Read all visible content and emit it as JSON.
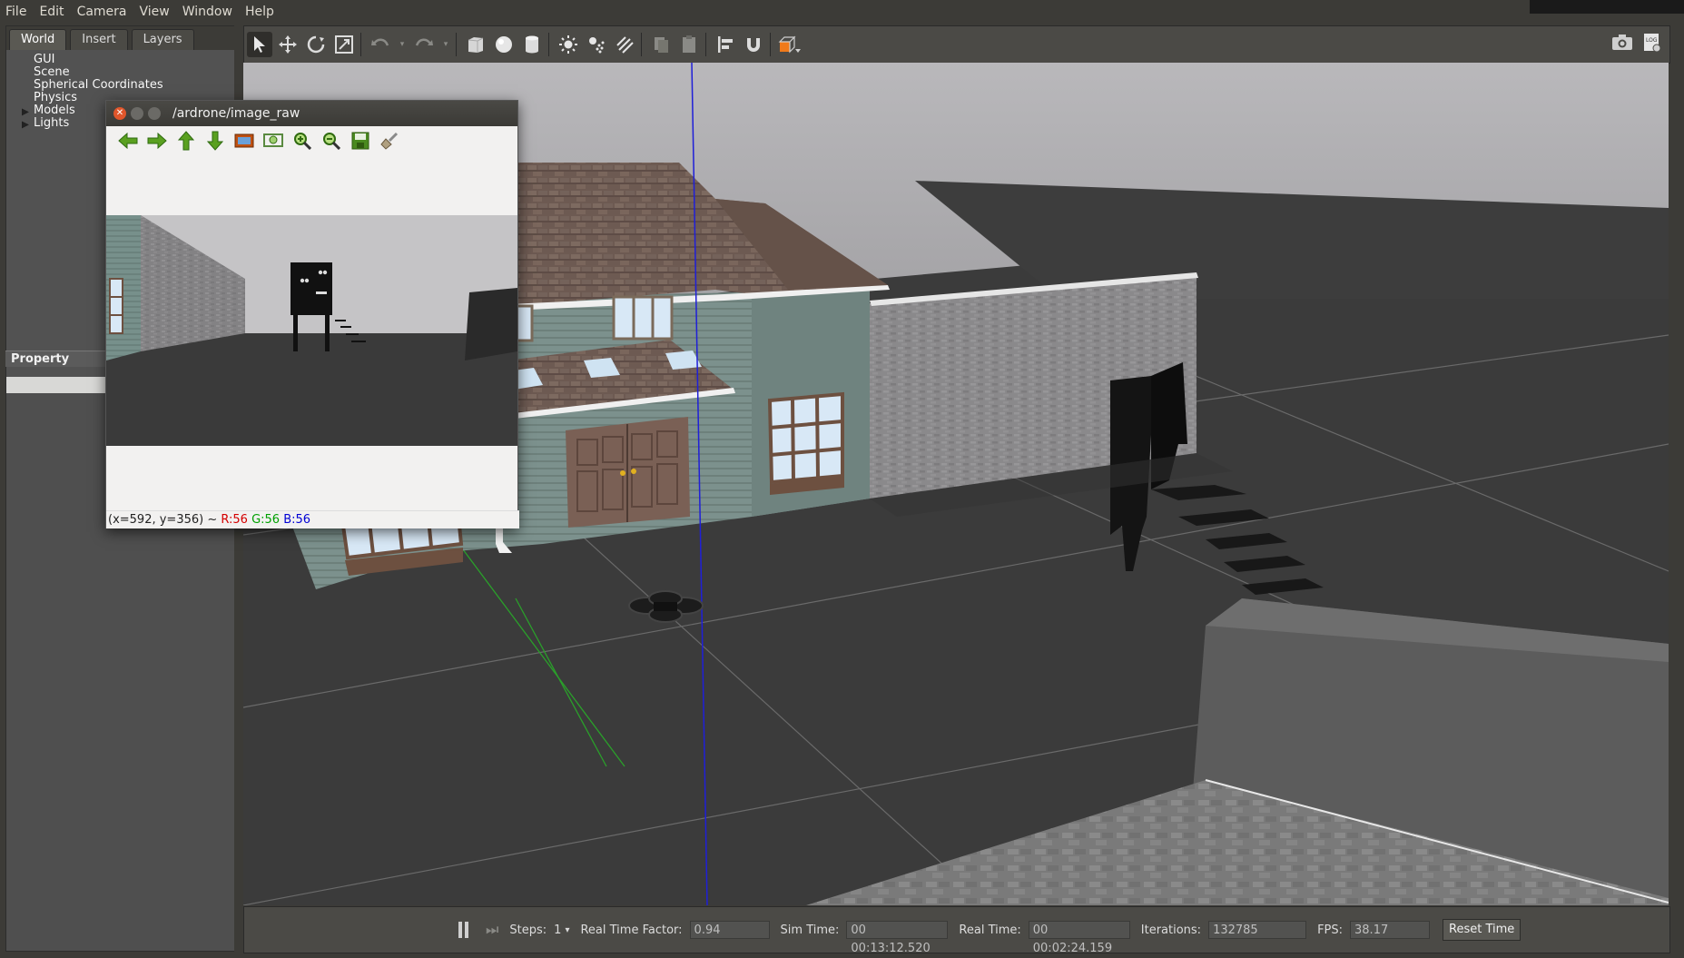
{
  "menu": [
    "File",
    "Edit",
    "Camera",
    "View",
    "Window",
    "Help"
  ],
  "left_panel": {
    "tabs": [
      "World",
      "Insert",
      "Layers"
    ],
    "tree_items": [
      {
        "label": "GUI",
        "expandable": false
      },
      {
        "label": "Scene",
        "expandable": false
      },
      {
        "label": "Spherical Coordinates",
        "expandable": false
      },
      {
        "label": "Physics",
        "expandable": false
      },
      {
        "label": "Models",
        "expandable": true
      },
      {
        "label": "Lights",
        "expandable": true
      }
    ],
    "property_header": "Property"
  },
  "toolbar": {
    "tools": [
      "select-icon",
      "translate-icon",
      "rotate-icon",
      "scale-icon",
      "undo-icon",
      "redo-icon",
      "box-icon",
      "sphere-icon",
      "cylinder-icon",
      "point-light-icon",
      "spot-light-icon",
      "directional-light-icon",
      "copy-icon",
      "paste-icon",
      "align-icon",
      "snap-icon",
      "view-angle-icon"
    ],
    "right_tools": [
      "screenshot-icon",
      "log-icon"
    ]
  },
  "image_window": {
    "title": "/ardrone/image_raw",
    "tools": [
      "back-icon",
      "forward-icon",
      "up-icon",
      "down-icon",
      "image-icon",
      "zoom-fit-icon",
      "zoom-in-icon",
      "zoom-out-icon",
      "save-icon",
      "clear-icon"
    ],
    "status_coords": "(x=592, y=356) ~ ",
    "status_r": "R:56",
    "status_g": "G:56",
    "status_b": "B:56"
  },
  "bottom_bar": {
    "steps_label": "Steps:",
    "steps_value": "1",
    "rtf_label": "Real Time Factor:",
    "rtf_value": "0.94",
    "sim_time_label": "Sim Time:",
    "sim_time_value": "00 00:13:12.520",
    "real_time_label": "Real Time:",
    "real_time_value": "00 00:02:24.159",
    "iterations_label": "Iterations:",
    "iterations_value": "132785",
    "fps_label": "FPS:",
    "fps_value": "38.17",
    "reset_label": "Reset Time"
  },
  "colors": {
    "accent_orange": "#f07a1a",
    "z_axis": "#1f1fd8",
    "y_axis": "#2aa02a"
  }
}
